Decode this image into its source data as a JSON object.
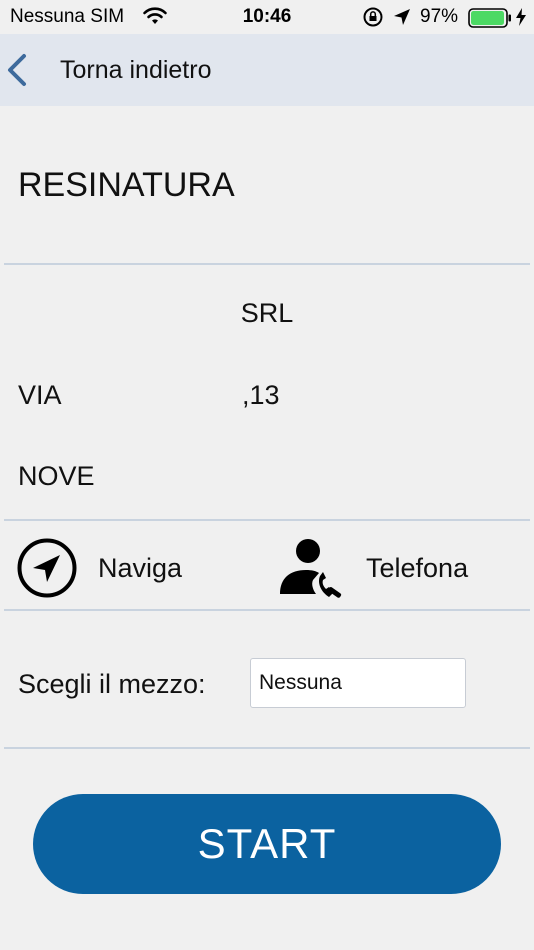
{
  "status_bar": {
    "carrier": "Nessuna SIM",
    "time": "10:46",
    "battery_percent": "97%",
    "battery_color": "#4cd964",
    "icons": [
      "wifi-icon",
      "orientation-lock-icon",
      "location-arrow-icon",
      "battery-icon",
      "charging-bolt-icon"
    ]
  },
  "nav": {
    "back_label": "Torna indietro",
    "back_icon": "chevron-left-icon",
    "accent_color": "#3d6a9c"
  },
  "company": {
    "name": "RESINATURA",
    "type": "SRL"
  },
  "address": {
    "street": "VIA",
    "number": ",13",
    "city": "NOVE"
  },
  "actions": {
    "navigate_label": "Naviga",
    "navigate_icon": "navigation-arrow-icon",
    "call_label": "Telefona",
    "call_icon": "person-phone-icon"
  },
  "vehicle": {
    "label": "Scegli il mezzo:",
    "selected": "Nessuna"
  },
  "start": {
    "label": "START",
    "color": "#0b62a0"
  }
}
